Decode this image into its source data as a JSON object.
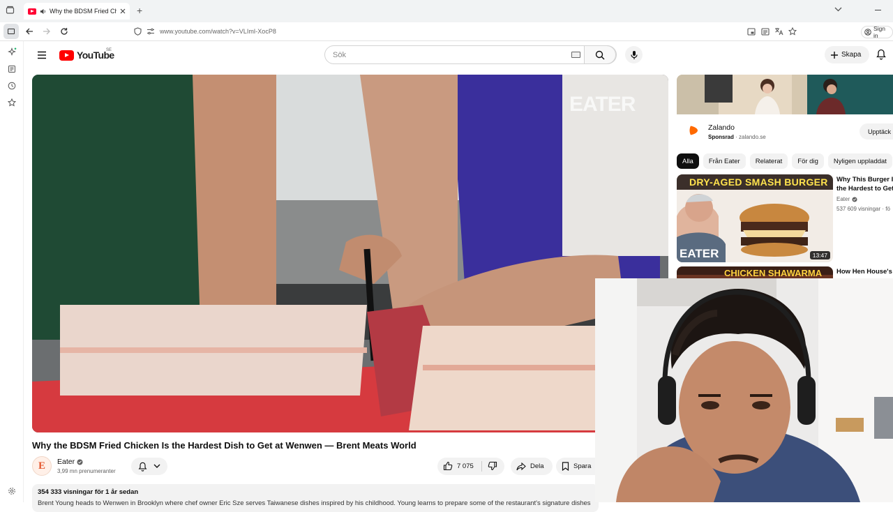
{
  "browser": {
    "tab_title": "Why the BDSM Fried Chicke",
    "url": "www.youtube.com/watch?v=VLImI-XocP8",
    "sign_in": "Sign in"
  },
  "youtube": {
    "logo_text": "YouTube",
    "region": "SE",
    "search_placeholder": "Sök",
    "create_label": "Skapa"
  },
  "video": {
    "watermark": "EATER",
    "title": "Why the BDSM Fried Chicken Is the Hardest Dish to Get at Wenwen — Brent Meats World",
    "channel": {
      "initial": "E",
      "name": "Eater",
      "subscribers": "3,99 mn prenumeranter"
    },
    "likes": "7 075",
    "share_label": "Dela",
    "save_label": "Spara",
    "views_date": "354 333 visningar  för 1 år sedan",
    "description": "Brent Young heads to Wenwen in Brooklyn where chef owner Eric Sze serves Taiwanese dishes inspired by his childhood. Young learns to prepare some of the restaurant's signature dishes"
  },
  "sidebar": {
    "ad": {
      "name": "Zalando",
      "sponsored": "Sponsrad",
      "domain": "zalando.se",
      "cta": "Upptäck"
    },
    "chips": [
      "Alla",
      "Från Eater",
      "Relaterat",
      "För dig",
      "Nyligen uppladdat"
    ],
    "recommendations": [
      {
        "thumb_text": "DRY-AGED SMASH BURGER",
        "thumb_brand": "EATER",
        "duration": "13:47",
        "title_line1": "Why This Burger Is",
        "title_line2": "the Hardest to Get",
        "channel": "Eater",
        "views": "537 609 visningar · fö"
      },
      {
        "thumb_text": "CHICKEN SHAWARMA",
        "title_line1": "How Hen House's C"
      }
    ]
  },
  "colors": {
    "youtube_red": "#ff0000",
    "zalando_orange": "#ff6900",
    "chip_active": "#0f0f0f"
  }
}
